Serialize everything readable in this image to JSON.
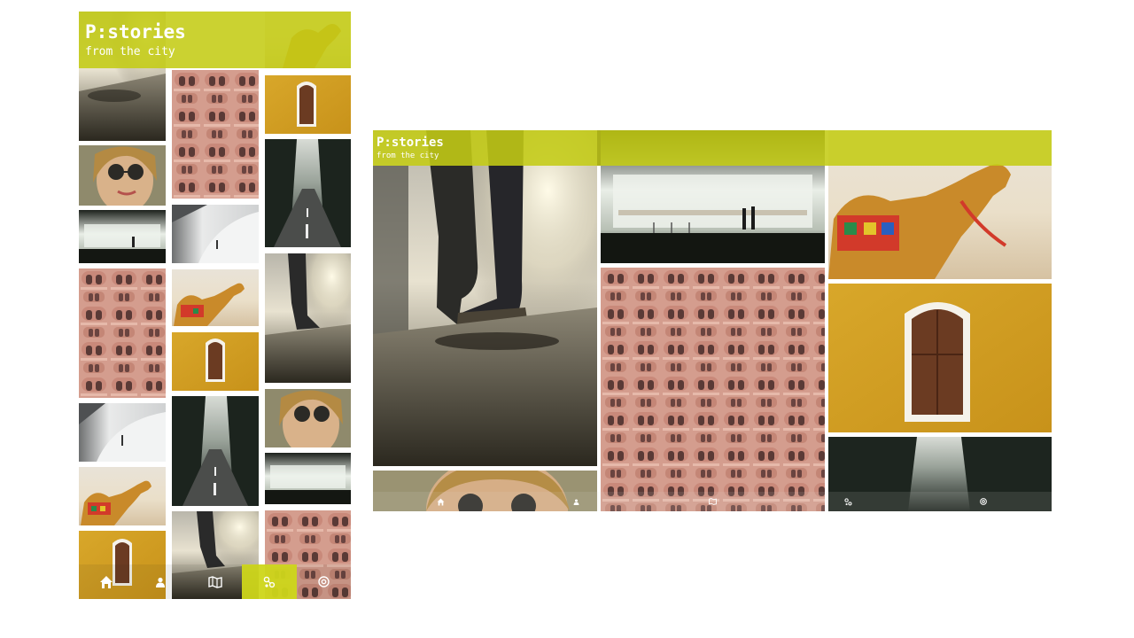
{
  "brand": {
    "title": "P:stories",
    "subtitle": "from the city"
  },
  "colors": {
    "accent": "#c8cf1f",
    "accent_dark": "#a9ae12",
    "nav_active": "#d3d92a"
  },
  "phone_gallery": {
    "columns": [
      [
        "road-sneaker-photo",
        "woman-sunglasses-photo",
        "apple-store-photo",
        "pink-palace-facade-photo",
        "white-architecture-photo",
        "decorated-camel-photo",
        "yellow-wall-window-photo"
      ],
      [
        "pink-palace-facade-photo",
        "white-architecture-photo",
        "decorated-camel-photo",
        "yellow-wall-window-photo",
        "forest-road-photo",
        "road-sneaker-photo"
      ],
      [
        "decorated-camel-photo",
        "yellow-wall-window-photo",
        "forest-road-photo",
        "road-sneaker-photo",
        "woman-sunglasses-photo",
        "apple-store-photo",
        "pink-palace-facade-photo"
      ]
    ]
  },
  "tablet_gallery": {
    "columns": [
      [
        "road-sneaker-photo",
        "woman-sunglasses-photo"
      ],
      [
        "apple-store-photo",
        "pink-palace-facade-photo"
      ],
      [
        "decorated-camel-photo",
        "yellow-wall-window-photo",
        "forest-road-photo"
      ]
    ]
  },
  "nav": {
    "items": [
      {
        "name": "home",
        "icon": "home-icon"
      },
      {
        "name": "profile",
        "icon": "person-icon"
      },
      {
        "name": "map",
        "icon": "map-icon"
      },
      {
        "name": "share",
        "icon": "share-icon"
      },
      {
        "name": "contact",
        "icon": "at-icon"
      }
    ],
    "active": "share"
  }
}
